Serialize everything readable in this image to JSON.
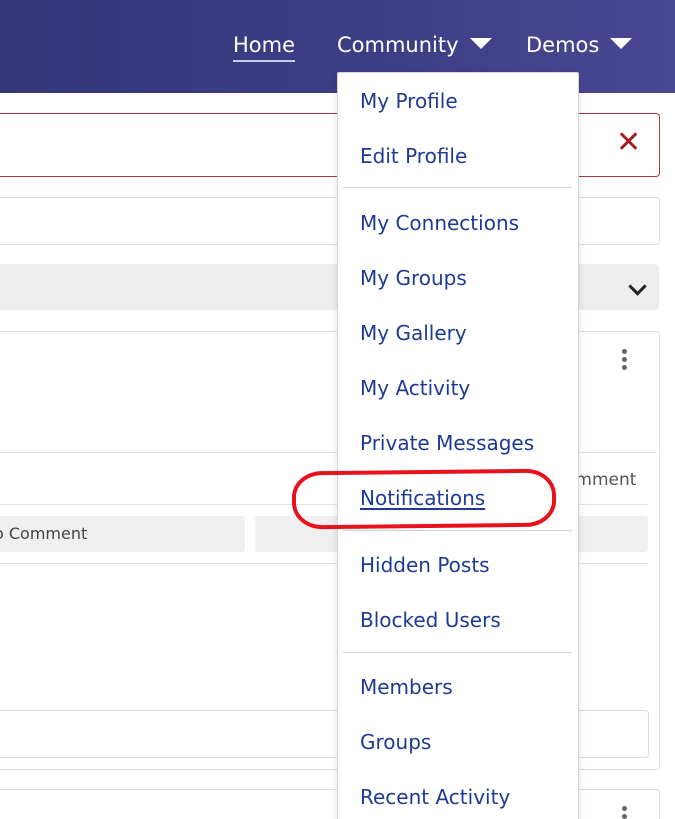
{
  "nav": {
    "home": "Home",
    "community": "Community",
    "demos": "Demos"
  },
  "alert": {
    "close_glyph": "✕"
  },
  "post": {
    "comment_count_text": "omment",
    "comment_button": "o Comment"
  },
  "menu": {
    "items": [
      "My Profile",
      "Edit Profile",
      "My Connections",
      "My Groups",
      "My Gallery",
      "My Activity",
      "Private Messages",
      "Notifications",
      "Hidden Posts",
      "Blocked Users",
      "Members",
      "Groups",
      "Recent Activity"
    ]
  },
  "colors": {
    "nav_bg": "#3d3f86",
    "menu_link": "#1f3a93",
    "highlight": "#e8121c",
    "alert_border": "#b2353b"
  }
}
